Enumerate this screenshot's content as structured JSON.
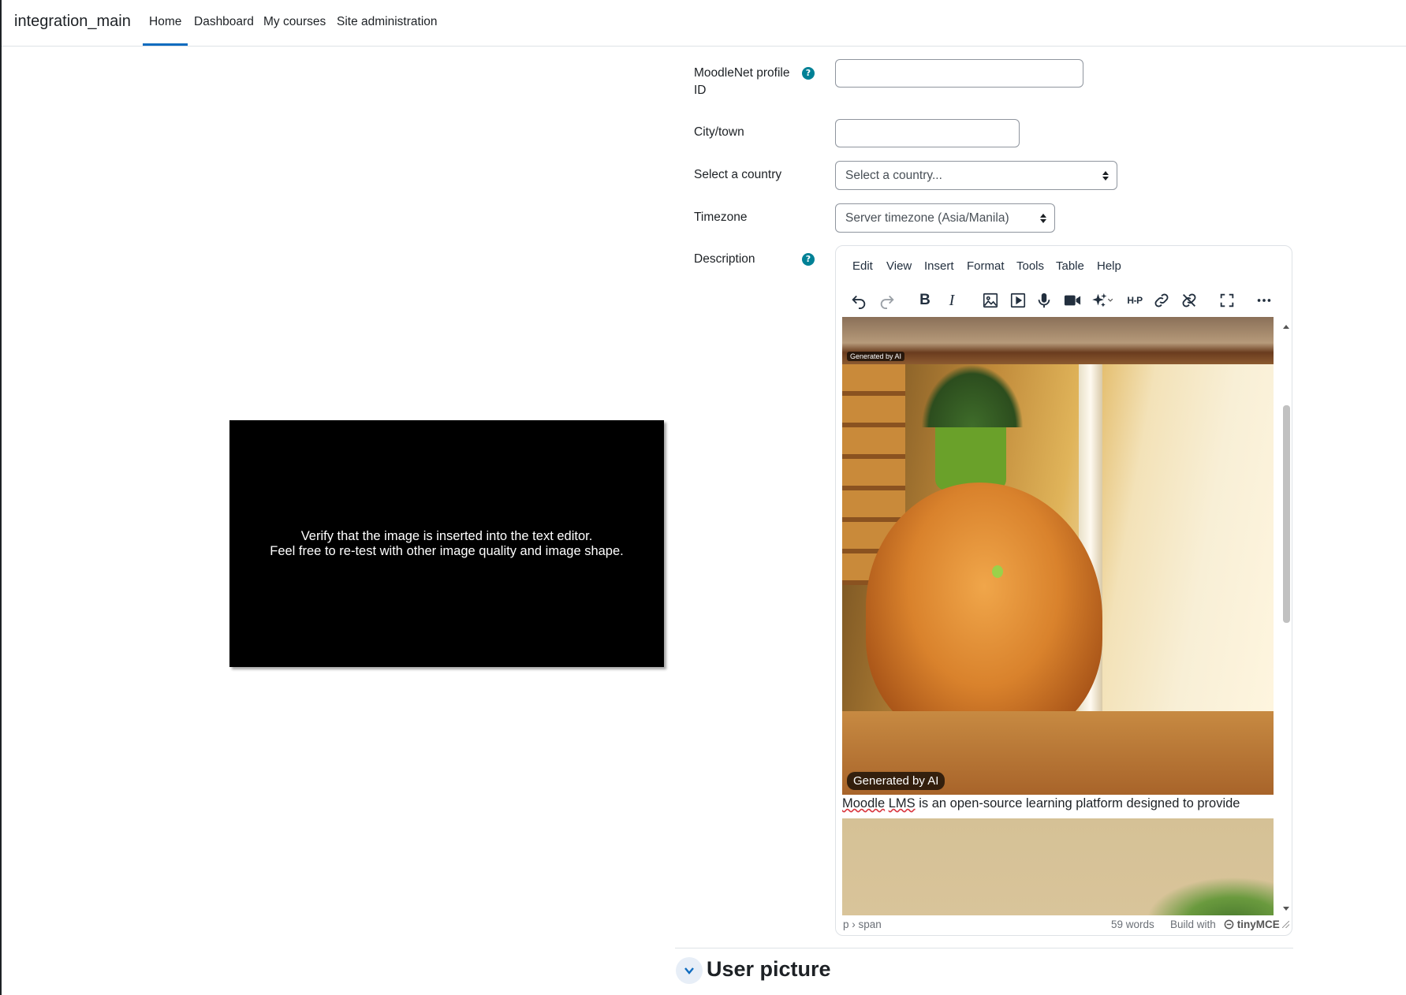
{
  "navbar": {
    "brand": "integration_main",
    "items": [
      {
        "label": "Home",
        "active": true
      },
      {
        "label": "Dashboard"
      },
      {
        "label": "My courses"
      },
      {
        "label": "Site administration"
      }
    ]
  },
  "form": {
    "moodlenet_label": "MoodleNet profile ID",
    "city_label": "City/town",
    "country_label": "Select a country",
    "country_value": "Select a country...",
    "timezone_label": "Timezone",
    "timezone_value": "Server timezone (Asia/Manila)",
    "description_label": "Description",
    "help_glyph": "?"
  },
  "editor": {
    "menus": [
      "Edit",
      "View",
      "Insert",
      "Format",
      "Tools",
      "Table",
      "Help"
    ],
    "toolbar_icons": [
      "undo-icon",
      "redo-icon",
      "bold-icon",
      "italic-icon",
      "image-icon",
      "media-icon",
      "record-audio-icon",
      "record-video-icon",
      "ai-sparkle-icon",
      "h5p-icon",
      "link-icon",
      "unlink-icon",
      "fullscreen-icon",
      "more-icon"
    ],
    "bold_glyph": "B",
    "italic_glyph": "I",
    "h5p_label": "H-P",
    "ai_badge_small": "Generated by AI",
    "ai_badge": "Generated by AI",
    "paragraph_word1": "Moodle",
    "paragraph_word2": "LMS",
    "paragraph_rest": " is an open-source learning platform designed to provide",
    "status_path": "p › span",
    "word_count": "59 words",
    "build_with": "Build with",
    "tinymce": "tinyMCE"
  },
  "overlay": {
    "line1": "Verify that the image is inserted into the text editor.",
    "line2": "Feel free to re-test with other image quality and image shape."
  },
  "section": {
    "title": "User picture"
  },
  "colors": {
    "accent": "#0f6cbf",
    "help": "#008196",
    "text": "#1d2125"
  }
}
